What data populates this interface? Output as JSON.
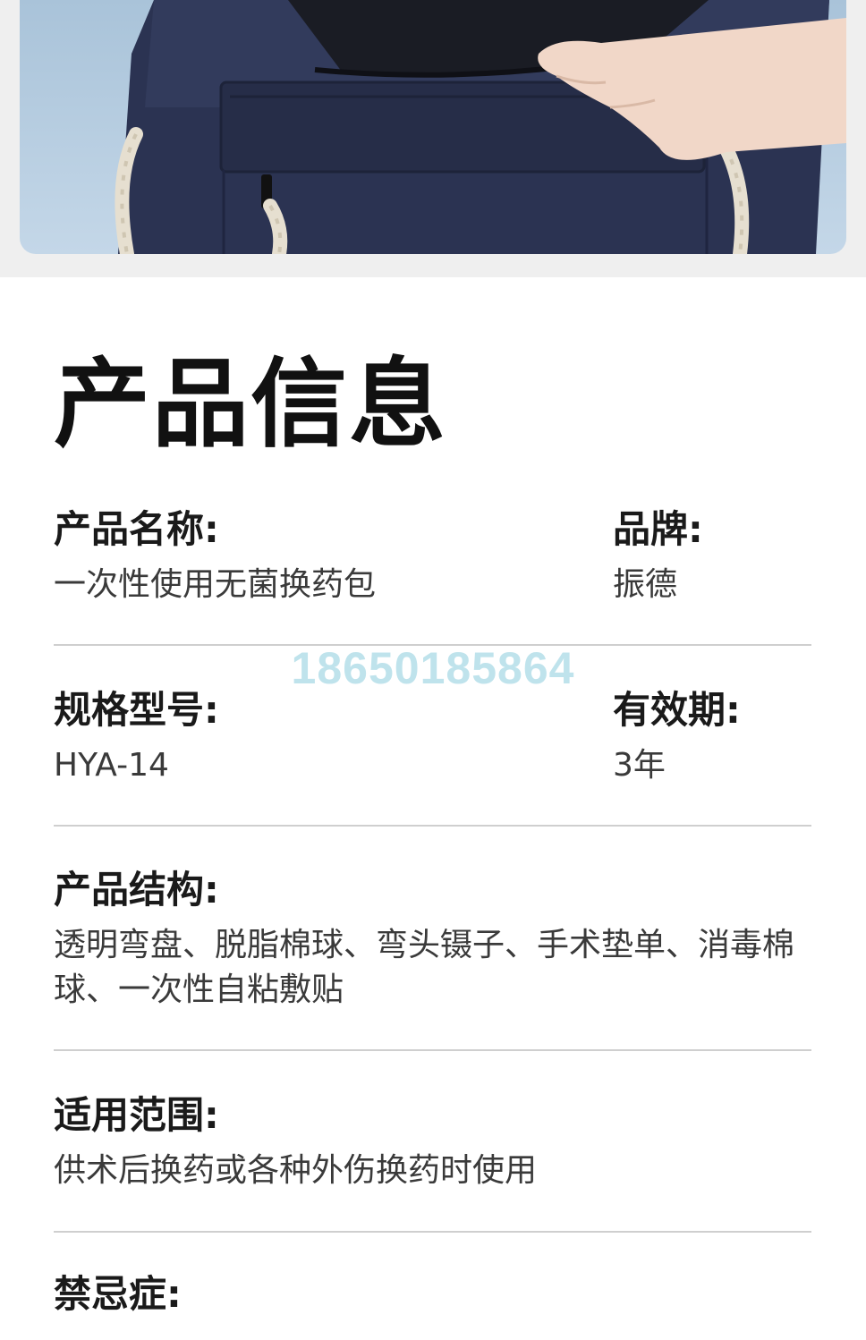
{
  "title": "产品信息",
  "fields": {
    "product_name": {
      "label": "产品名称:",
      "value": "一次性使用无菌换药包"
    },
    "brand": {
      "label": "品牌:",
      "value": "振德"
    },
    "model": {
      "label": "规格型号:",
      "value": "HYA-14"
    },
    "validity": {
      "label": "有效期:",
      "value": "3年"
    },
    "structure": {
      "label": "产品结构:",
      "value": "透明弯盘、脱脂棉球、弯头镊子、手术垫单、消毒棉球、一次性自粘敷贴"
    },
    "scope": {
      "label": "适用范围:",
      "value": "供术后换药或各种外伤换药时使用"
    },
    "contraindication": {
      "label": "禁忌症:",
      "value": ""
    }
  },
  "watermark": "18650185864",
  "colors": {
    "bag": "#2b3352",
    "sky": "#b7cde0",
    "watermark": "#bfe3ec",
    "divider": "#cfcfcf"
  }
}
